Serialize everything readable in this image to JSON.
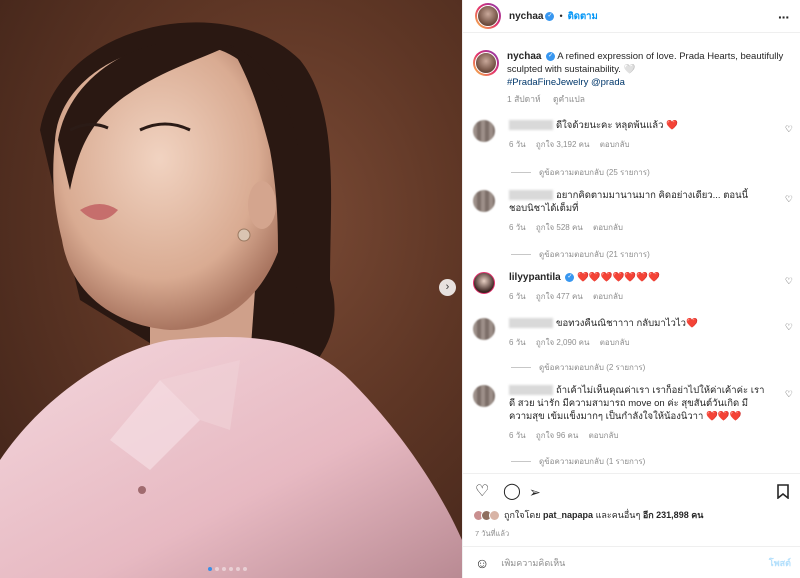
{
  "post": {
    "username": "nychaa",
    "follow_label": "ติดตาม",
    "separator": "•",
    "caption_text": "A refined expression of love. Prada Hearts, beautifully sculpted with sustainability. 🤍",
    "hashtag": "#PradaFineJewelry",
    "mention": "@prada",
    "caption_age": "1 สัปดาห์",
    "translate_label": "ดูคำแปล"
  },
  "comments": [
    {
      "text": "ดีใจด้วยนะคะ หลุดพ้นแล้ว",
      "emoji": "❤️",
      "age": "6 วัน",
      "likes": "ถูกใจ 3,192 คน",
      "reply_label": "ตอบกลับ",
      "replies": "ดูข้อความตอบกลับ (25 รายการ)"
    },
    {
      "text": "อยากคิดตามมานานมาก คิดอย่างเดียว... ตอนนี้ชอบนิชาได้เต็มที่",
      "age": "6 วัน",
      "likes": "ถูกใจ 528 คน",
      "reply_label": "ตอบกลับ",
      "replies": "ดูข้อความตอบกลับ (21 รายการ)"
    },
    {
      "username": "lilyypantila",
      "text": "❤️❤️❤️❤️❤️❤️❤️",
      "age": "6 วัน",
      "likes": "ถูกใจ 477 คน",
      "reply_label": "ตอบกลับ"
    },
    {
      "text": "ขอทวงคืนณิชาาาา กลับมาไวไว",
      "emoji": "❤️",
      "age": "6 วัน",
      "likes": "ถูกใจ 2,090 คน",
      "reply_label": "ตอบกลับ",
      "replies": "ดูข้อความตอบกลับ (2 รายการ)"
    },
    {
      "text": "ถ้าเค้าไม่เห็นคุณค่าเรา เราก็อย่าไปให้ค่าเค้าค่ะ เราดี สวย น่ารัก มีความสามารถ move on ค่ะ สุขสันต์วันเกิด มีความสุข เข้มแข็งมากๆ เป็นกำลังใจให้น้องนิวาา",
      "emoji": "❤️❤️❤️",
      "age": "6 วัน",
      "likes": "ถูกใจ 96 คน",
      "reply_label": "ตอบกลับ",
      "replies": "ดูข้อความตอบกลับ (1 รายการ)"
    }
  ],
  "actions": {
    "like_icon": "heart-outline-icon",
    "comment_icon": "comment-icon",
    "share_icon": "paper-plane-icon",
    "save_icon": "bookmark-icon"
  },
  "likes_summary": {
    "prefix": "ถูกใจโดย",
    "user": "pat_napapa",
    "middle": "และคนอื่นๆ",
    "count": "อีก 231,898 คน"
  },
  "post_date": "7 วันที่แล้ว",
  "composer": {
    "placeholder": "เพิ่มความคิดเห็น",
    "post_label": "โพสต์"
  },
  "carousel": {
    "total": 6,
    "current": 1
  },
  "colors": {
    "accent": "#0095f6",
    "verified": "#3897f0",
    "heart": "#ed1c24",
    "active_dot": "#3b8fe6"
  }
}
